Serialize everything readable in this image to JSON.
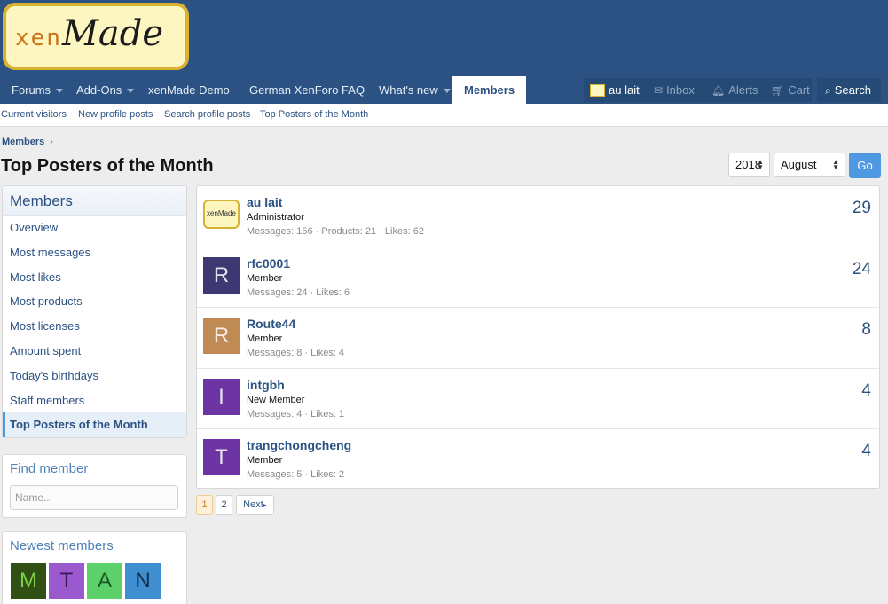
{
  "logo": {
    "xen": "xen",
    "made": "Made"
  },
  "nav": {
    "forums": "Forums",
    "addons": "Add-Ons",
    "demo": "xenMade Demo",
    "faq": "German XenForo FAQ",
    "whats_new": "What's new",
    "members": "Members"
  },
  "user_nav": {
    "username": "au lait",
    "inbox": "Inbox",
    "alerts": "Alerts",
    "cart": "Cart",
    "search": "Search"
  },
  "subnav": {
    "current_visitors": "Current visitors",
    "new_profile_posts": "New profile posts",
    "search_profile_posts": "Search profile posts",
    "top_posters": "Top Posters of the Month"
  },
  "breadcrumb": {
    "members": "Members",
    "sep": "›"
  },
  "page_title": "Top Posters of the Month",
  "filters": {
    "year": "2018",
    "month": "August",
    "go": "Go"
  },
  "sidebar": {
    "title": "Members",
    "items": [
      "Overview",
      "Most messages",
      "Most likes",
      "Most products",
      "Most licenses",
      "Amount spent",
      "Today's birthdays",
      "Staff members",
      "Top Posters of the Month"
    ]
  },
  "find_member": {
    "title": "Find member",
    "placeholder": "Name..."
  },
  "newest_members": {
    "title": "Newest members",
    "avatars": [
      {
        "letter": "M",
        "color": "#2f4f14",
        "text_color": "#7fd04a"
      },
      {
        "letter": "T",
        "color": "#9b59d0",
        "text_color": "#3a1a55"
      },
      {
        "letter": "A",
        "color": "#5bd06b",
        "text_color": "#1d5a26"
      },
      {
        "letter": "N",
        "color": "#3f8fd0",
        "text_color": "#0d2e4f"
      }
    ]
  },
  "members": [
    {
      "name": "au lait",
      "title": "Administrator",
      "stats": "Messages: 156 · Products: 21 · Likes: 62",
      "count": "29",
      "avatar_letter": "xenMade",
      "avatar_color": "#fdf6c0",
      "is_logo": true
    },
    {
      "name": "rfc0001",
      "title": "Member",
      "stats": "Messages: 24 · Likes: 6",
      "count": "24",
      "avatar_letter": "R",
      "avatar_color": "#3b3872"
    },
    {
      "name": "Route44",
      "title": "Member",
      "stats": "Messages: 8 · Likes: 4",
      "count": "8",
      "avatar_letter": "R",
      "avatar_color": "#c08a54"
    },
    {
      "name": "intgbh",
      "title": "New Member",
      "stats": "Messages: 4 · Likes: 1",
      "count": "4",
      "avatar_letter": "I",
      "avatar_color": "#6c35a3"
    },
    {
      "name": "trangchongcheng",
      "title": "Member",
      "stats": "Messages: 5 · Likes: 2",
      "count": "4",
      "avatar_letter": "T",
      "avatar_color": "#6c35a3"
    }
  ],
  "pagination": {
    "page1": "1",
    "page2": "2",
    "next": "Next"
  }
}
